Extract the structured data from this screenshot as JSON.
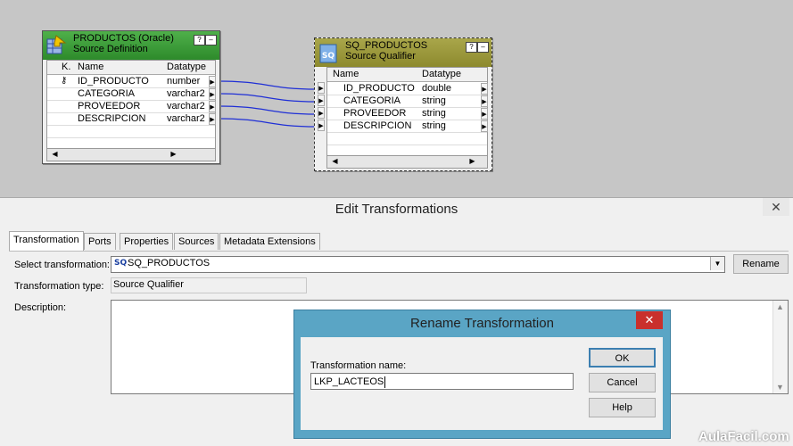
{
  "canvas": {
    "source": {
      "title": "PRODUCTOS (Oracle)",
      "subtitle": "Source Definition",
      "help_label": "?",
      "min_label": "–",
      "columns": [
        "K.",
        "Name",
        "Datatype"
      ],
      "rows": [
        {
          "key": true,
          "name": "ID_PRODUCTO",
          "type": "number"
        },
        {
          "key": false,
          "name": "CATEGORIA",
          "type": "varchar2"
        },
        {
          "key": false,
          "name": "PROVEEDOR",
          "type": "varchar2"
        },
        {
          "key": false,
          "name": "DESCRIPCION",
          "type": "varchar2"
        }
      ]
    },
    "qualifier": {
      "title": "SQ_PRODUCTOS",
      "subtitle": "Source Qualifier",
      "help_label": "?",
      "min_label": "–",
      "icon_text": "SQ",
      "columns": [
        "Name",
        "Datatype"
      ],
      "rows": [
        {
          "name": "ID_PRODUCTO",
          "type": "double"
        },
        {
          "name": "CATEGORIA",
          "type": "string"
        },
        {
          "name": "PROVEEDOR",
          "type": "string"
        },
        {
          "name": "DESCRIPCION",
          "type": "string"
        }
      ]
    },
    "link_color": "#1f2fd6"
  },
  "edit": {
    "title": "Edit Transformations",
    "close_label": "✕",
    "tabs": [
      "Transformation",
      "Ports",
      "Properties",
      "Sources",
      "Metadata Extensions"
    ],
    "select_label": "Select transformation:",
    "select_icon_text": "SQ",
    "select_value": "SQ_PRODUCTOS",
    "rename_button": "Rename",
    "type_label": "Transformation type:",
    "type_value": "Source Qualifier",
    "description_label": "Description:",
    "description_value": ""
  },
  "rename": {
    "title": "Rename Transformation",
    "close_label": "✕",
    "field_label": "Transformation name:",
    "field_value": "LKP_LACTEOS",
    "ok_label": "OK",
    "cancel_label": "Cancel",
    "help_label": "Help"
  },
  "watermark": "AulaFacil.com"
}
